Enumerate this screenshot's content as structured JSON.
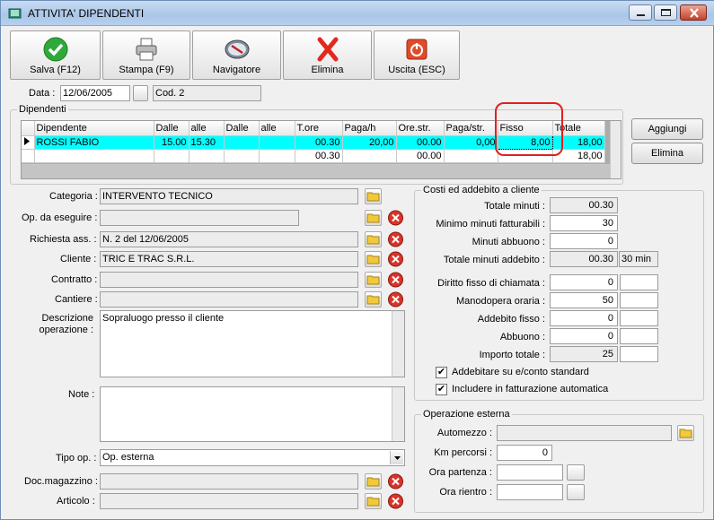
{
  "window": {
    "title": "ATTIVITA' DIPENDENTI"
  },
  "toolbar": {
    "save_label": "Salva (F12)",
    "print_label": "Stampa (F9)",
    "navigator_label": "Navigatore",
    "delete_label": "Elimina",
    "exit_label": "Uscita (ESC)"
  },
  "header": {
    "date_label": "Data :",
    "date_value": "12/06/2005",
    "code_value": "Cod. 2"
  },
  "employees": {
    "group_title": "Dipendenti",
    "columns": [
      "Dipendente",
      "Dalle",
      "alle",
      "Dalle",
      "alle",
      "T.ore",
      "Paga/h",
      "Ore.str.",
      "Paga/str.",
      "Fisso",
      "Totale"
    ],
    "rows": [
      [
        "ROSSI FABIO",
        "15.00",
        "15.30",
        "",
        "",
        "00.30",
        "20,00",
        "00.00",
        "0,00",
        "8,00",
        "18,00"
      ]
    ],
    "totals": [
      "",
      "",
      "",
      "",
      "",
      "00.30",
      "",
      "00.00",
      "",
      "",
      "18,00"
    ],
    "add_button": "Aggiungi",
    "delete_button": "Elimina"
  },
  "form": {
    "category_label": "Categoria :",
    "category_value": "INTERVENTO TECNICO",
    "todo_label": "Op. da eseguire :",
    "todo_value": "",
    "request_label": "Richiesta ass. :",
    "request_value": "N. 2 del 12/06/2005",
    "customer_label": "Cliente :",
    "customer_value": "TRIC E TRAC S.R.L.",
    "contract_label": "Contratto :",
    "contract_value": "",
    "site_label": "Cantiere :",
    "site_value": "",
    "description_label_1": "Descrizione",
    "description_label_2": "operazione :",
    "description_value": "Sopraluogo presso il cliente",
    "notes_label": "Note :",
    "notes_value": "",
    "optype_label": "Tipo op. :",
    "optype_value": "Op. esterna",
    "warehouse_label": "Doc.magazzino :",
    "warehouse_value": "",
    "article_label": "Articolo :",
    "article_value": ""
  },
  "costs": {
    "group_title": "Costi ed addebito a cliente",
    "total_minutes_label": "Totale minuti :",
    "total_minutes_value": "00.30",
    "min_billable_label": "Minimo minuti fatturabili :",
    "min_billable_value": "30",
    "discount_minutes_label": "Minuti abbuono :",
    "discount_minutes_value": "0",
    "charged_minutes_label": "Totale minuti addebito :",
    "charged_minutes_value": "00.30",
    "charged_minutes_extra": "30 min",
    "call_fee_label": "Diritto fisso di chiamata :",
    "call_fee_value": "0",
    "hourly_labor_label": "Manodopera oraria :",
    "hourly_labor_value": "50",
    "fixed_charge_label": "Addebito fisso :",
    "fixed_charge_value": "0",
    "discount_label": "Abbuono :",
    "discount_value": "0",
    "total_amount_label": "Importo totale :",
    "total_amount_value": "25",
    "standard_charge_label": "Addebitare su e/conto standard",
    "auto_invoice_label": "Includere in fatturazione automatica"
  },
  "external": {
    "group_title": "Operazione esterna",
    "vehicle_label": "Automezzo :",
    "vehicle_value": "",
    "km_label": "Km percorsi :",
    "km_value": "0",
    "departure_label": "Ora partenza :",
    "departure_value": "",
    "return_label": "Ora rientro :",
    "return_value": ""
  },
  "colors": {
    "selected_row": "#00ffff",
    "highlight_circle": "#e02020"
  }
}
